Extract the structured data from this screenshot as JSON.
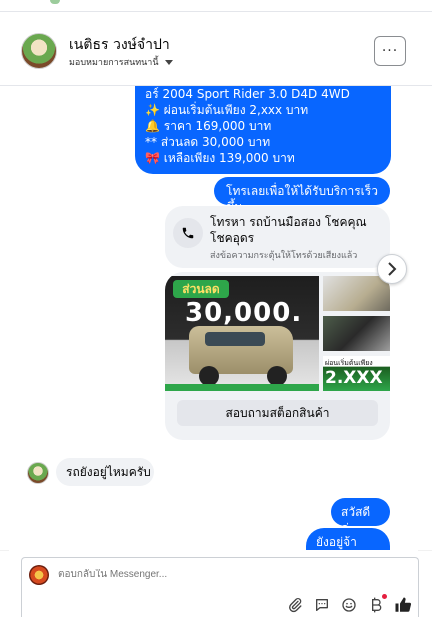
{
  "header": {
    "page_name": "เนติธร วงษ์จำปา",
    "page_subtitle": "มอบหมายการสนทนานี้",
    "more_label": "···"
  },
  "messages": {
    "offer_lines": [
      "อร์ 2004 Sport Rider 3.0 D4D 4WD",
      "✨ ผ่อนเริ่มต้นเพียง 2,xxx บาท",
      "🔔 ราคา 169,000 บาท",
      "** ส่วนลด 30,000 บาท",
      "🎀 เหลือเพียง 139,000 บาท"
    ],
    "cta_text": "โทรเลยเพื่อให้ได้รับบริการเร็วขึ้น",
    "call_card": {
      "title": "โทรหา รถบ้านมือสอง โชคคุณ โชคอุดร",
      "subtitle": "ส่งข้อความกระตุ้นให้โทรด้วยเสียงแล้ว"
    },
    "product_card": {
      "badge_text": "ส่วนลด",
      "big_text": "30,000.",
      "thumb_caption": "ผ่อนเริ่มต้นเพียง",
      "thumb_amount": "2.XXX",
      "stock_button": "สอบถามสต็อกสินค้า"
    },
    "incoming_text": "รถยังอยู่ไหมครับ",
    "reply_hi": "สวัสดีค่ะ",
    "reply_alive": "ยังอยู่จ้าลูกค้า"
  },
  "composer": {
    "placeholder": "ตอบกลับใน Messenger..."
  },
  "icons": [
    "attach-icon",
    "comment-icon",
    "emoji-icon",
    "bitcoin-icon",
    "thumbs-up-icon",
    "phone-icon",
    "chevron-right-icon"
  ],
  "colors": {
    "accent": "#0866ff",
    "bubble_gray": "#f0f2f5",
    "promo_green": "#2ea64a"
  }
}
